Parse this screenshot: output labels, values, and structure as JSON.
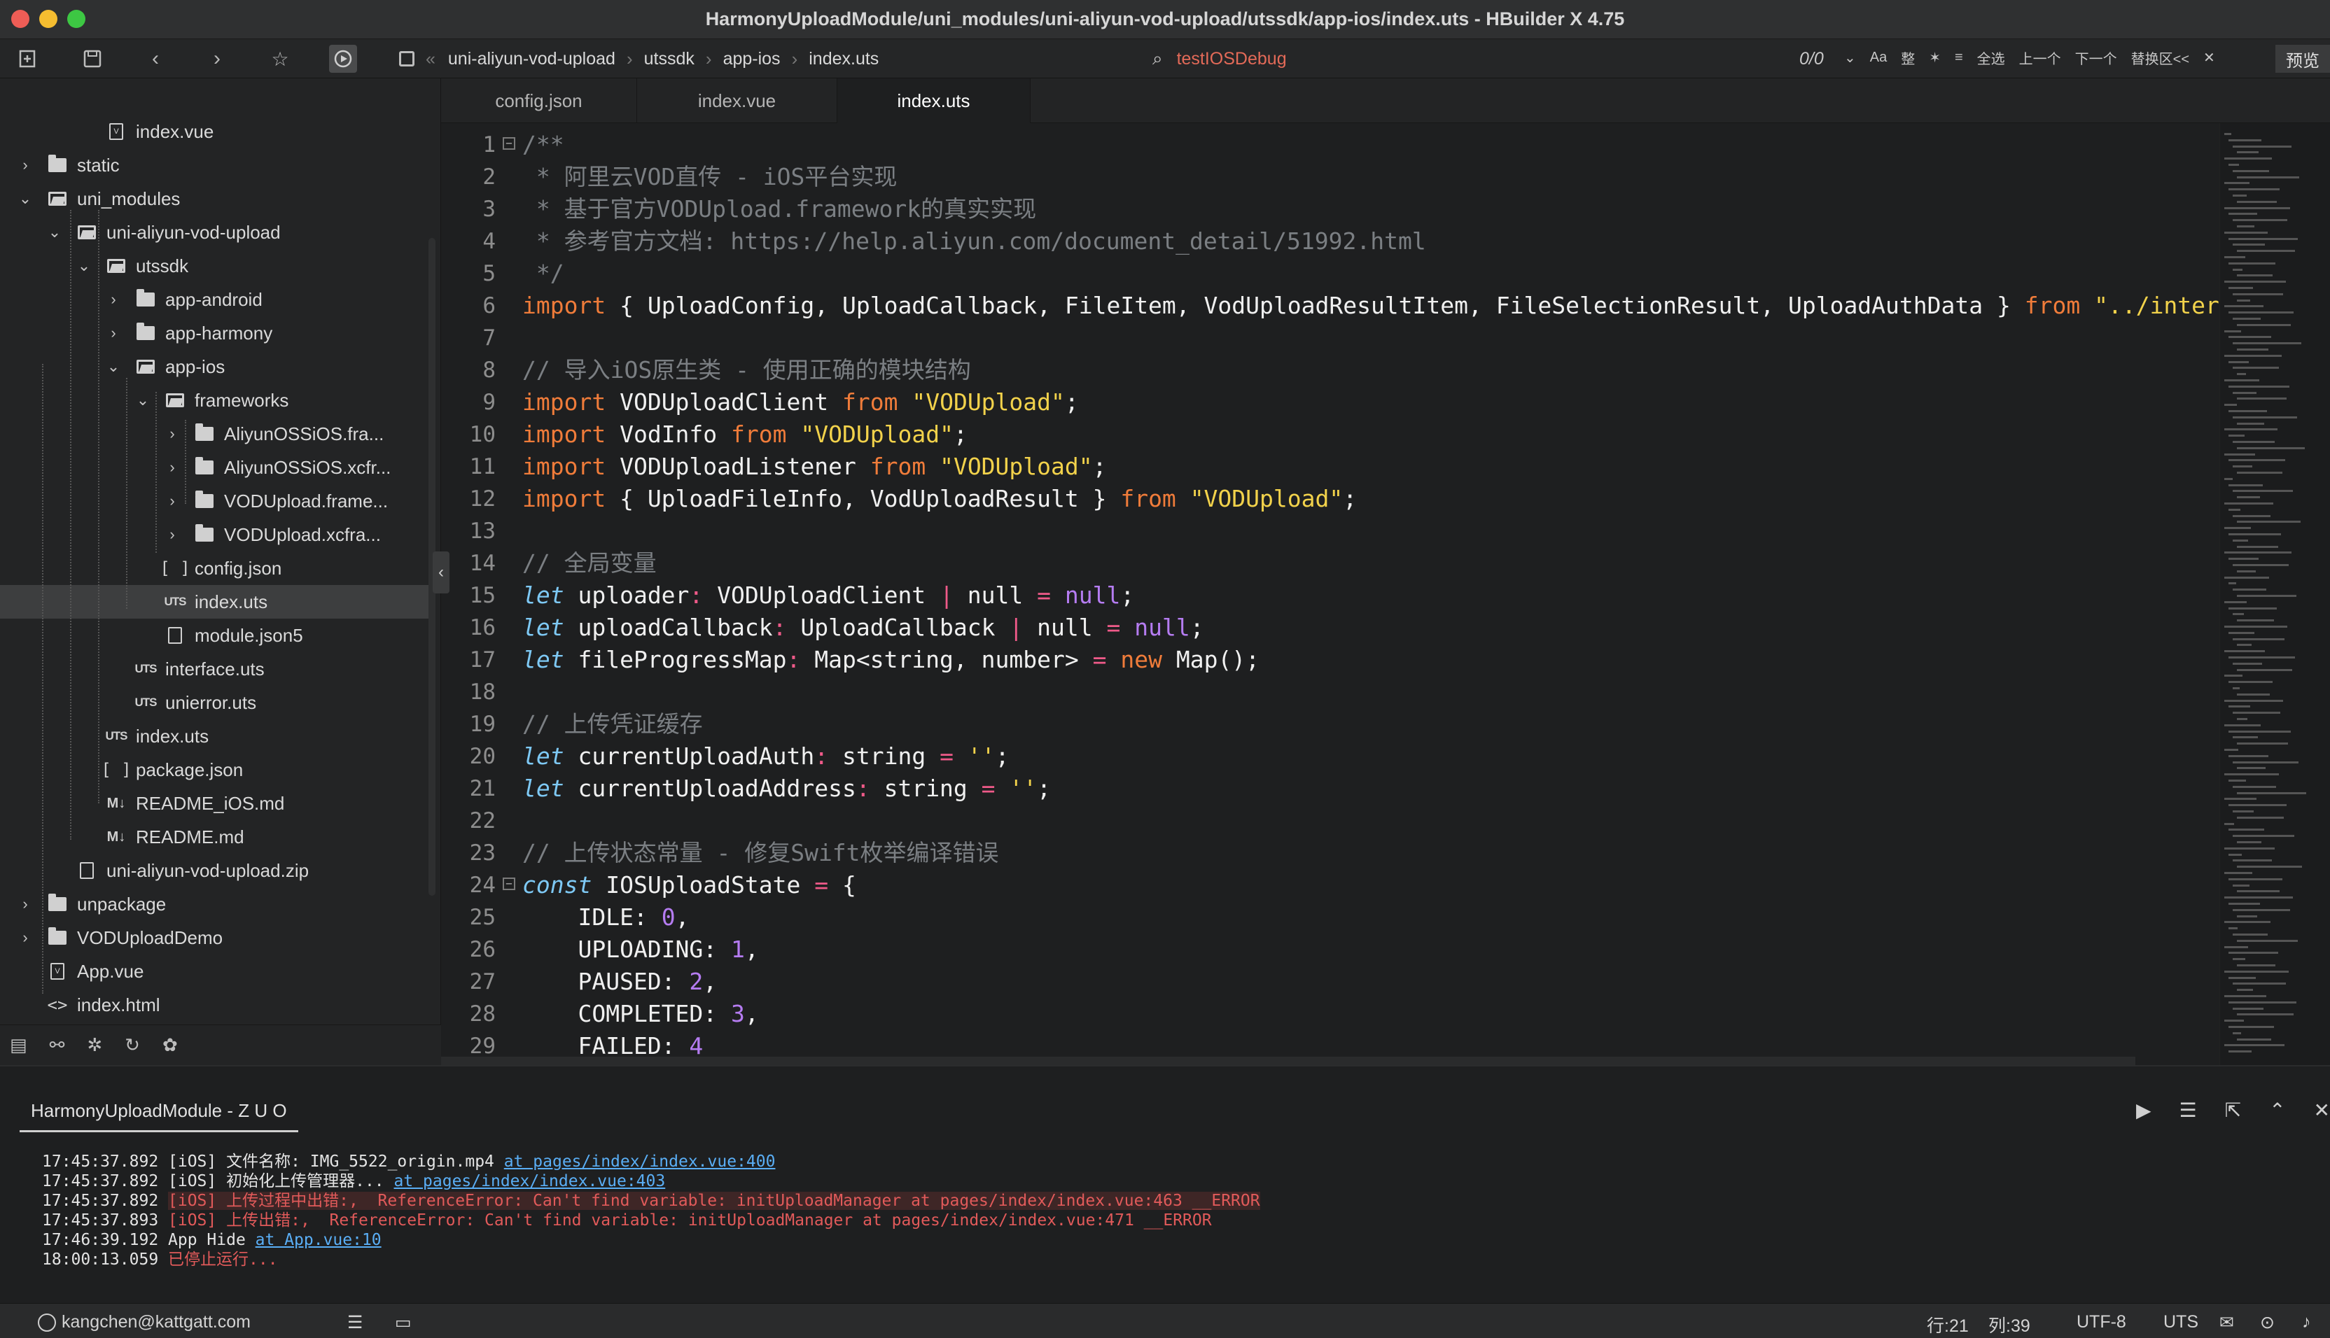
{
  "window": {
    "title": "HarmonyUploadModule/uni_modules/uni-aliyun-vod-upload/utssdk/app-ios/index.uts - HBuilder X 4.75"
  },
  "toolbar": {
    "breadcrumb": [
      "uni-aliyun-vod-upload",
      "utssdk",
      "app-ios",
      "index.uts"
    ],
    "run_target": "testIOSDebug",
    "find_count": "0/0",
    "find_options": [
      "Aa",
      "整",
      "✶",
      "≡",
      "全选",
      "上一个",
      "下一个",
      "替换区<<",
      "✕"
    ],
    "preview_label": "预览"
  },
  "sidebar": {
    "items": [
      {
        "label": "index.vue",
        "depth": 3,
        "icon": "vue-file-icon",
        "chevron": ""
      },
      {
        "label": "static",
        "depth": 1,
        "icon": "folder-icon",
        "chevron": "›"
      },
      {
        "label": "uni_modules",
        "depth": 1,
        "icon": "folder-open-icon",
        "chevron": "⌄"
      },
      {
        "label": "uni-aliyun-vod-upload",
        "depth": 2,
        "icon": "folder-open-icon",
        "chevron": "⌄"
      },
      {
        "label": "utssdk",
        "depth": 3,
        "icon": "folder-open-icon",
        "chevron": "⌄"
      },
      {
        "label": "app-android",
        "depth": 4,
        "icon": "folder-icon",
        "chevron": "›"
      },
      {
        "label": "app-harmony",
        "depth": 4,
        "icon": "folder-icon",
        "chevron": "›"
      },
      {
        "label": "app-ios",
        "depth": 4,
        "icon": "folder-open-icon",
        "chevron": "⌄"
      },
      {
        "label": "frameworks",
        "depth": 5,
        "icon": "folder-open-icon",
        "chevron": "⌄"
      },
      {
        "label": "AliyunOSSiOS.fra...",
        "depth": 6,
        "icon": "folder-icon",
        "chevron": "›"
      },
      {
        "label": "AliyunOSSiOS.xcfr...",
        "depth": 6,
        "icon": "folder-icon",
        "chevron": "›"
      },
      {
        "label": "VODUpload.frame...",
        "depth": 6,
        "icon": "folder-icon",
        "chevron": "›"
      },
      {
        "label": "VODUpload.xcfra...",
        "depth": 6,
        "icon": "folder-icon",
        "chevron": "›"
      },
      {
        "label": "config.json",
        "depth": 5,
        "icon": "json-file-icon",
        "chevron": ""
      },
      {
        "label": "index.uts",
        "depth": 5,
        "icon": "uts-file-icon",
        "chevron": "",
        "selected": true
      },
      {
        "label": "module.json5",
        "depth": 5,
        "icon": "blank-file-icon",
        "chevron": ""
      },
      {
        "label": "interface.uts",
        "depth": 4,
        "icon": "uts-file-icon",
        "chevron": ""
      },
      {
        "label": "unierror.uts",
        "depth": 4,
        "icon": "uts-file-icon",
        "chevron": ""
      },
      {
        "label": "index.uts",
        "depth": 3,
        "icon": "uts-file-icon",
        "chevron": ""
      },
      {
        "label": "package.json",
        "depth": 3,
        "icon": "json-file-icon",
        "chevron": ""
      },
      {
        "label": "README_iOS.md",
        "depth": 3,
        "icon": "markdown-file-icon",
        "chevron": ""
      },
      {
        "label": "README.md",
        "depth": 3,
        "icon": "markdown-file-icon",
        "chevron": ""
      },
      {
        "label": "uni-aliyun-vod-upload.zip",
        "depth": 2,
        "icon": "blank-file-icon",
        "chevron": ""
      },
      {
        "label": "unpackage",
        "depth": 1,
        "icon": "folder-icon",
        "chevron": "›"
      },
      {
        "label": "VODUploadDemo",
        "depth": 1,
        "icon": "folder-icon",
        "chevron": "›"
      },
      {
        "label": "App.vue",
        "depth": 1,
        "icon": "vue-file-icon",
        "chevron": ""
      },
      {
        "label": "index.html",
        "depth": 1,
        "icon": "html-file-icon",
        "chevron": ""
      }
    ]
  },
  "tabs": [
    {
      "label": "config.json",
      "active": false
    },
    {
      "label": "index.vue",
      "active": false
    },
    {
      "label": "index.uts",
      "active": true
    }
  ],
  "code_lines": [
    {
      "n": "1",
      "fold": "−",
      "html": "<span class=\"c\">/**</span>"
    },
    {
      "n": "2",
      "html": "<span class=\"c\"> * 阿里云VOD直传 - iOS平台实现</span>"
    },
    {
      "n": "3",
      "html": "<span class=\"c\"> * 基于官方VODUpload.framework的真实实现</span>"
    },
    {
      "n": "4",
      "html": "<span class=\"c\"> * 参考官方文档: https://help.aliyun.com/document_detail/51992.html</span>"
    },
    {
      "n": "5",
      "html": "<span class=\"c\"> */</span>"
    },
    {
      "n": "6",
      "html": "<span class=\"k\">import</span> { UploadConfig, UploadCallback, FileItem, VodUploadResultItem, FileSelectionResult, UploadAuthData } <span class=\"k\">from</span> <span class=\"s\">\"../interface</span>"
    },
    {
      "n": "7",
      "html": ""
    },
    {
      "n": "8",
      "html": "<span class=\"c\">// 导入iOS原生类 - 使用正确的模块结构</span>"
    },
    {
      "n": "9",
      "html": "<span class=\"k\">import</span> VODUploadClient <span class=\"k\">from</span> <span class=\"s\">\"VODUpload\"</span>;"
    },
    {
      "n": "10",
      "html": "<span class=\"k\">import</span> VodInfo <span class=\"k\">from</span> <span class=\"s\">\"VODUpload\"</span>;"
    },
    {
      "n": "11",
      "html": "<span class=\"k\">import</span> VODUploadListener <span class=\"k\">from</span> <span class=\"s\">\"VODUpload\"</span>;"
    },
    {
      "n": "12",
      "html": "<span class=\"k\">import</span> { UploadFileInfo, VodUploadResult } <span class=\"k\">from</span> <span class=\"s\">\"VODUpload\"</span>;"
    },
    {
      "n": "13",
      "html": ""
    },
    {
      "n": "14",
      "html": "<span class=\"c\">// 全局变量</span>"
    },
    {
      "n": "15",
      "html": "<span class=\"i\">let</span> uploader<span class=\"o\">:</span> VODUploadClient <span class=\"o\">|</span> null <span class=\"o\">=</span> <span class=\"n\">null</span>;"
    },
    {
      "n": "16",
      "html": "<span class=\"i\">let</span> uploadCallback<span class=\"o\">:</span> UploadCallback <span class=\"o\">|</span> null <span class=\"o\">=</span> <span class=\"n\">null</span>;"
    },
    {
      "n": "17",
      "html": "<span class=\"i\">let</span> fileProgressMap<span class=\"o\">:</span> Map&lt;string, number&gt; <span class=\"o\">=</span> <span class=\"k\">new</span> Map();"
    },
    {
      "n": "18",
      "html": ""
    },
    {
      "n": "19",
      "html": "<span class=\"c\">// 上传凭证缓存</span>"
    },
    {
      "n": "20",
      "html": "<span class=\"i\">let</span> currentUploadAuth<span class=\"o\">:</span> string <span class=\"o\">=</span> <span class=\"s\">''</span>;"
    },
    {
      "n": "21",
      "html": "<span class=\"i\">let</span> currentUploadAddress<span class=\"o\">:</span> string <span class=\"o\">=</span> <span class=\"s\">''</span>;"
    },
    {
      "n": "22",
      "html": ""
    },
    {
      "n": "23",
      "html": "<span class=\"c\">// 上传状态常量 - 修复Swift枚举编译错误</span>"
    },
    {
      "n": "24",
      "fold": "−",
      "html": "<span class=\"i\">const</span> IOSUploadState <span class=\"o\">=</span> {"
    },
    {
      "n": "25",
      "html": "    IDLE: <span class=\"n\">0</span>,"
    },
    {
      "n": "26",
      "html": "    UPLOADING: <span class=\"n\">1</span>,"
    },
    {
      "n": "27",
      "html": "    PAUSED: <span class=\"n\">2</span>,"
    },
    {
      "n": "28",
      "html": "    COMPLETED: <span class=\"n\">3</span>,"
    },
    {
      "n": "29",
      "html": "    FAILED: <span class=\"n\">4</span>"
    }
  ],
  "console": {
    "tab_label": "HarmonyUploadModule - Z U O",
    "lines": [
      {
        "html": "17:45:37.892 [iOS] 文件名称: IMG_5522_origin.mp4 <span class=\"lnk\">at pages/index/index.vue:400</span>"
      },
      {
        "html": "17:45:37.892 [iOS] 初始化上传管理器... <span class=\"lnk\">at pages/index/index.vue:403</span>"
      },
      {
        "html": "17:45:37.892 <span class=\"errbg\">[iOS] 上传过程中出错:,  ReferenceError: Can't find variable: initUploadManager at pages/index/index.vue:463 __ERROR</span>"
      },
      {
        "html": "17:45:37.893 <span class=\"err\">[iOS] 上传出错:,  ReferenceError: Can't find variable: initUploadManager at pages/index/index.vue:471 __ERROR</span>"
      },
      {
        "html": "17:46:39.192 App Hide <span class=\"lnk\">at App.vue:10</span>"
      },
      {
        "html": "18:00:13.059 <span class=\"err\">已停止运行...</span>"
      }
    ]
  },
  "statusbar": {
    "user": "kangchen@kattgatt.com",
    "position_line": "行:21",
    "position_col": "列:39",
    "encoding": "UTF-8",
    "language": "UTS"
  },
  "colors": {
    "close": "#ee5d56",
    "minimize": "#f5bd30",
    "maximize": "#3dc743",
    "keyword": "#f07c3a",
    "string": "#f2d24b",
    "comment": "#7b7f83",
    "error": "#e15a5a",
    "link": "#5aaef5"
  }
}
